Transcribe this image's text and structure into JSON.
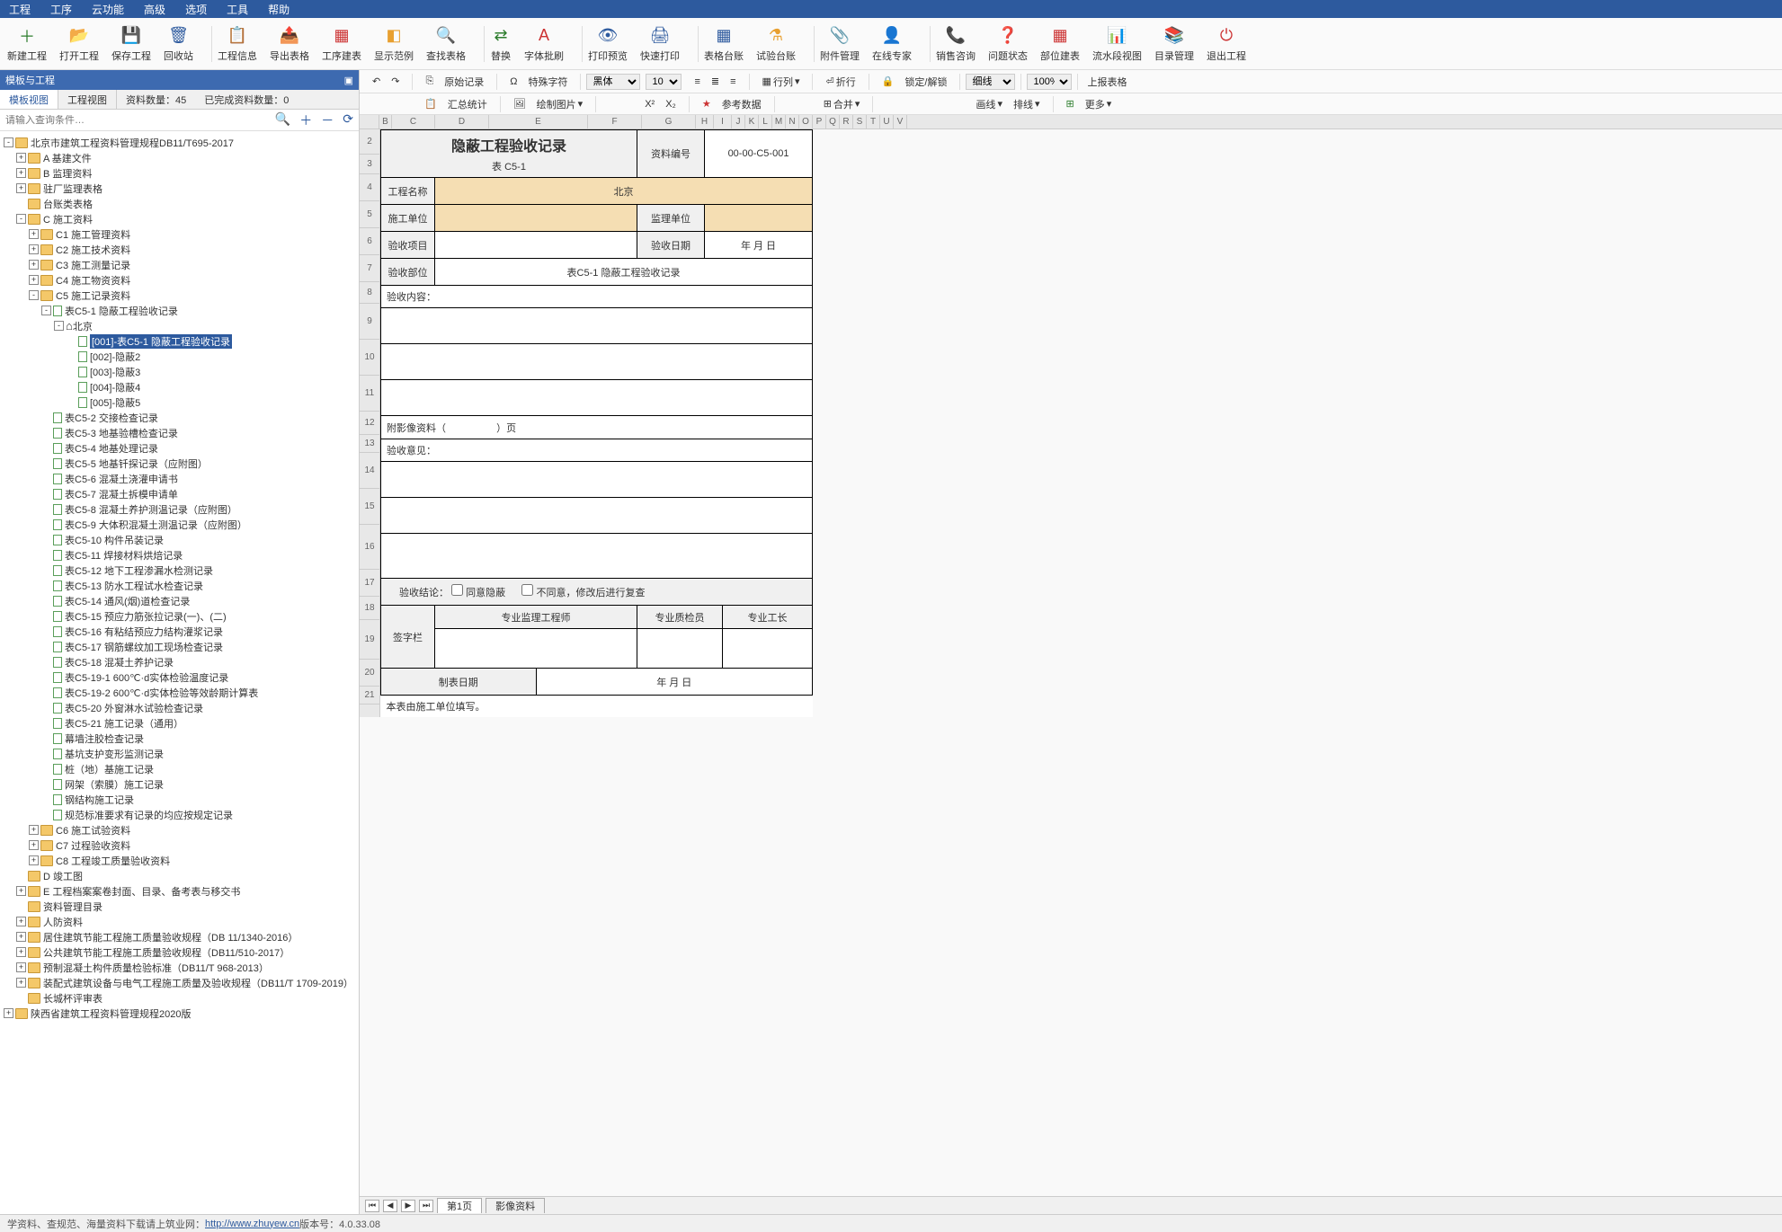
{
  "menubar": [
    "工程",
    "工序",
    "云功能",
    "高级",
    "选项",
    "工具",
    "帮助"
  ],
  "toolbar": [
    {
      "icon": "＋",
      "label": "新建工程",
      "color": "#2d7d2d"
    },
    {
      "icon": "📂",
      "label": "打开工程",
      "color": "#e8a030"
    },
    {
      "icon": "💾",
      "label": "保存工程",
      "color": "#2d5a9e"
    },
    {
      "icon": "🗑",
      "label": "回收站",
      "color": "#2d5a9e"
    },
    {
      "sep": true
    },
    {
      "icon": "📋",
      "label": "工程信息",
      "color": "#e8a030"
    },
    {
      "icon": "📤",
      "label": "导出表格",
      "color": "#2d7d2d"
    },
    {
      "icon": "▦",
      "label": "工序建表",
      "color": "#cc3333"
    },
    {
      "icon": "◧",
      "label": "显示范例",
      "color": "#e8a030"
    },
    {
      "icon": "🔍",
      "label": "查找表格",
      "color": "#2d5a9e"
    },
    {
      "sep": true
    },
    {
      "icon": "⇄",
      "label": "替换",
      "color": "#2d7d2d"
    },
    {
      "icon": "A",
      "label": "字体批刷",
      "color": "#cc3333"
    },
    {
      "sep": true
    },
    {
      "icon": "👁",
      "label": "打印预览",
      "color": "#2d5a9e"
    },
    {
      "icon": "🖨",
      "label": "快速打印",
      "color": "#2d5a9e"
    },
    {
      "sep": true
    },
    {
      "icon": "▦",
      "label": "表格台账",
      "color": "#2d5a9e"
    },
    {
      "icon": "⚗",
      "label": "试验台账",
      "color": "#e8a030"
    },
    {
      "sep": true
    },
    {
      "icon": "📎",
      "label": "附件管理",
      "color": "#cc3333"
    },
    {
      "icon": "👤",
      "label": "在线专家",
      "color": "#2d7d2d"
    },
    {
      "sep": true
    },
    {
      "icon": "📞",
      "label": "销售咨询",
      "color": "#e8a030"
    },
    {
      "icon": "❓",
      "label": "问题状态",
      "color": "#2d5a9e"
    },
    {
      "icon": "▦",
      "label": "部位建表",
      "color": "#cc3333"
    },
    {
      "icon": "📊",
      "label": "流水段视图",
      "color": "#2d5a9e"
    },
    {
      "icon": "📚",
      "label": "目录管理",
      "color": "#e8a030"
    },
    {
      "icon": "⏻",
      "label": "退出工程",
      "color": "#cc3333"
    }
  ],
  "leftPanel": {
    "title": "模板与工程",
    "tabs": [
      {
        "label": "模板视图",
        "active": true
      },
      {
        "label": "工程视图",
        "active": false
      }
    ],
    "info1": "资料数量：45",
    "info2": "已完成资料数量：0",
    "searchPlaceholder": "请输入查询条件…"
  },
  "tree": [
    {
      "l": 0,
      "t": "-",
      "i": "folder-open",
      "label": "北京市建筑工程资料管理规程DB11/T695-2017"
    },
    {
      "l": 1,
      "t": "+",
      "i": "folder-closed",
      "label": "A 基建文件"
    },
    {
      "l": 1,
      "t": "+",
      "i": "folder-closed",
      "label": "B 监理资料"
    },
    {
      "l": 1,
      "t": "+",
      "i": "folder-closed",
      "label": "驻厂监理表格"
    },
    {
      "l": 1,
      "t": "",
      "i": "folder-closed",
      "label": "台账类表格"
    },
    {
      "l": 1,
      "t": "-",
      "i": "folder-open",
      "label": "C 施工资料"
    },
    {
      "l": 2,
      "t": "+",
      "i": "folder-closed",
      "label": "C1 施工管理资料"
    },
    {
      "l": 2,
      "t": "+",
      "i": "folder-closed",
      "label": "C2 施工技术资料"
    },
    {
      "l": 2,
      "t": "+",
      "i": "folder-closed",
      "label": "C3 施工测量记录"
    },
    {
      "l": 2,
      "t": "+",
      "i": "folder-closed",
      "label": "C4 施工物资资料"
    },
    {
      "l": 2,
      "t": "-",
      "i": "folder-open",
      "label": "C5 施工记录资料"
    },
    {
      "l": 3,
      "t": "-",
      "i": "file-icon",
      "label": "表C5-1 隐蔽工程验收记录"
    },
    {
      "l": 4,
      "t": "-",
      "i": "home",
      "label": "北京"
    },
    {
      "l": 5,
      "t": "",
      "i": "file-icon",
      "label": "[001]-表C5-1 隐蔽工程验收记录",
      "selected": true
    },
    {
      "l": 5,
      "t": "",
      "i": "file-icon",
      "label": "[002]-隐蔽2"
    },
    {
      "l": 5,
      "t": "",
      "i": "file-icon",
      "label": "[003]-隐蔽3"
    },
    {
      "l": 5,
      "t": "",
      "i": "file-icon",
      "label": "[004]-隐蔽4"
    },
    {
      "l": 5,
      "t": "",
      "i": "file-icon",
      "label": "[005]-隐蔽5"
    },
    {
      "l": 3,
      "t": "",
      "i": "file-icon",
      "label": "表C5-2 交接检查记录"
    },
    {
      "l": 3,
      "t": "",
      "i": "file-icon",
      "label": "表C5-3 地基验槽检查记录"
    },
    {
      "l": 3,
      "t": "",
      "i": "file-icon",
      "label": "表C5-4 地基处理记录"
    },
    {
      "l": 3,
      "t": "",
      "i": "file-icon",
      "label": "表C5-5 地基钎探记录（应附图）"
    },
    {
      "l": 3,
      "t": "",
      "i": "file-icon",
      "label": "表C5-6 混凝土浇灌申请书"
    },
    {
      "l": 3,
      "t": "",
      "i": "file-icon",
      "label": "表C5-7 混凝土拆模申请单"
    },
    {
      "l": 3,
      "t": "",
      "i": "file-icon",
      "label": "表C5-8 混凝土养护测温记录（应附图）"
    },
    {
      "l": 3,
      "t": "",
      "i": "file-icon",
      "label": "表C5-9 大体积混凝土测温记录（应附图）"
    },
    {
      "l": 3,
      "t": "",
      "i": "file-icon",
      "label": "表C5-10 构件吊装记录"
    },
    {
      "l": 3,
      "t": "",
      "i": "file-icon",
      "label": "表C5-11 焊接材料烘焙记录"
    },
    {
      "l": 3,
      "t": "",
      "i": "file-icon",
      "label": "表C5-12 地下工程渗漏水检测记录"
    },
    {
      "l": 3,
      "t": "",
      "i": "file-icon",
      "label": "表C5-13 防水工程试水检查记录"
    },
    {
      "l": 3,
      "t": "",
      "i": "file-icon",
      "label": "表C5-14 通风(烟)道检查记录"
    },
    {
      "l": 3,
      "t": "",
      "i": "file-icon",
      "label": "表C5-15 预应力筋张拉记录(一)、(二)"
    },
    {
      "l": 3,
      "t": "",
      "i": "file-icon",
      "label": "表C5-16 有粘结预应力结构灌浆记录"
    },
    {
      "l": 3,
      "t": "",
      "i": "file-icon",
      "label": "表C5-17 钢筋螺纹加工现场检查记录"
    },
    {
      "l": 3,
      "t": "",
      "i": "file-icon",
      "label": "表C5-18 混凝土养护记录"
    },
    {
      "l": 3,
      "t": "",
      "i": "file-icon",
      "label": "表C5-19-1 600℃·d实体检验温度记录"
    },
    {
      "l": 3,
      "t": "",
      "i": "file-icon",
      "label": "表C5-19-2 600℃·d实体检验等效龄期计算表"
    },
    {
      "l": 3,
      "t": "",
      "i": "file-icon",
      "label": "表C5-20 外窗淋水试验检查记录"
    },
    {
      "l": 3,
      "t": "",
      "i": "file-icon",
      "label": "表C5-21 施工记录（通用）"
    },
    {
      "l": 3,
      "t": "",
      "i": "file-icon",
      "label": "幕墙注胶检查记录"
    },
    {
      "l": 3,
      "t": "",
      "i": "file-icon",
      "label": "基坑支护变形监测记录"
    },
    {
      "l": 3,
      "t": "",
      "i": "file-icon",
      "label": "桩（地）基施工记录"
    },
    {
      "l": 3,
      "t": "",
      "i": "file-icon",
      "label": "网架（索膜）施工记录"
    },
    {
      "l": 3,
      "t": "",
      "i": "file-icon",
      "label": "钢结构施工记录"
    },
    {
      "l": 3,
      "t": "",
      "i": "file-icon",
      "label": "规范标准要求有记录的均应按规定记录"
    },
    {
      "l": 2,
      "t": "+",
      "i": "folder-closed",
      "label": "C6 施工试验资料"
    },
    {
      "l": 2,
      "t": "+",
      "i": "folder-closed",
      "label": "C7 过程验收资料"
    },
    {
      "l": 2,
      "t": "+",
      "i": "folder-closed",
      "label": "C8 工程竣工质量验收资料"
    },
    {
      "l": 1,
      "t": "",
      "i": "folder-closed",
      "label": "D 竣工图"
    },
    {
      "l": 1,
      "t": "+",
      "i": "folder-closed",
      "label": "E 工程档案案卷封面、目录、备考表与移交书"
    },
    {
      "l": 1,
      "t": "",
      "i": "folder-closed",
      "label": "资料管理目录"
    },
    {
      "l": 1,
      "t": "+",
      "i": "folder-closed",
      "label": "人防资料"
    },
    {
      "l": 1,
      "t": "+",
      "i": "folder-closed",
      "label": "居住建筑节能工程施工质量验收规程（DB 11/1340-2016）"
    },
    {
      "l": 1,
      "t": "+",
      "i": "folder-closed",
      "label": "公共建筑节能工程施工质量验收规程（DB11/510-2017）"
    },
    {
      "l": 1,
      "t": "+",
      "i": "folder-closed",
      "label": "预制混凝土构件质量检验标准（DB11/T 968-2013）"
    },
    {
      "l": 1,
      "t": "+",
      "i": "folder-closed",
      "label": "装配式建筑设备与电气工程施工质量及验收规程（DB11/T 1709-2019）"
    },
    {
      "l": 1,
      "t": "",
      "i": "folder-closed",
      "label": "长城杯评审表"
    },
    {
      "l": 0,
      "t": "+",
      "i": "folder-closed",
      "label": "陕西省建筑工程资料管理规程2020版"
    }
  ],
  "rightToolbar": {
    "row1": {
      "originalRecord": "原始记录",
      "specialChar": "特殊字符",
      "font": "黑体",
      "fontSize": "10",
      "rowCol": "行列",
      "merge": "合并",
      "wrap": "折行",
      "lockUnlock": "锁定/解锁",
      "lineStyle": "细线",
      "zoom": "100%",
      "upload": "上报表格"
    },
    "row2": {
      "sumStat": "汇总统计",
      "drawChart": "绘制图片",
      "refData": "参考数据",
      "drawLine": "画线",
      "sort": "排线",
      "more": "更多"
    }
  },
  "cols": [
    "",
    "B",
    "C",
    "D",
    "E",
    "F",
    "G",
    "H",
    "I",
    "J",
    "K",
    "L",
    "M",
    "N",
    "O",
    "P",
    "Q",
    "R",
    "S",
    "T",
    "U",
    "V"
  ],
  "rows": [
    "2",
    "3",
    "4",
    "5",
    "6",
    "7",
    "8",
    "9",
    "10",
    "11",
    "12",
    "13",
    "14",
    "15",
    "16",
    "17",
    "18",
    "19",
    "20",
    "21"
  ],
  "form": {
    "title": "隐蔽工程验收记录",
    "subtitle": "表 C5-1",
    "docNoLabel": "资料编号",
    "docNo": "00-00-C5-001",
    "projNameLabel": "工程名称",
    "projName": "北京",
    "constUnitLabel": "施工单位",
    "supervisorLabel": "监理单位",
    "inspectItemLabel": "验收项目",
    "inspectDateLabel": "验收日期",
    "dateText": "年  月  日",
    "inspectPartLabel": "验收部位",
    "inspectPartVal": "表C5-1 隐蔽工程验收记录",
    "contentLabel": "验收内容：",
    "attachLabel": "附影像资料（",
    "attachSuffix": "）页",
    "opinionLabel": "验收意见：",
    "conclusionLabel": "验收结论：",
    "cb1": "同意隐蔽",
    "cb2": "不同意，修改后进行复查",
    "signLabel": "签字栏",
    "role1": "专业监理工程师",
    "role2": "专业质检员",
    "role3": "专业工长",
    "makeDateLabel": "制表日期",
    "makeDateVal": "年  月  日",
    "note": "本表由施工单位填写。"
  },
  "sheetTabs": {
    "page": "第1页",
    "attach": "影像资料"
  },
  "statusbar": {
    "text1": "学资料、查规范、海量资料下载请上筑业网：",
    "link": "http://www.zhuyew.cn",
    "text2": " 版本号：4.0.33.08"
  }
}
